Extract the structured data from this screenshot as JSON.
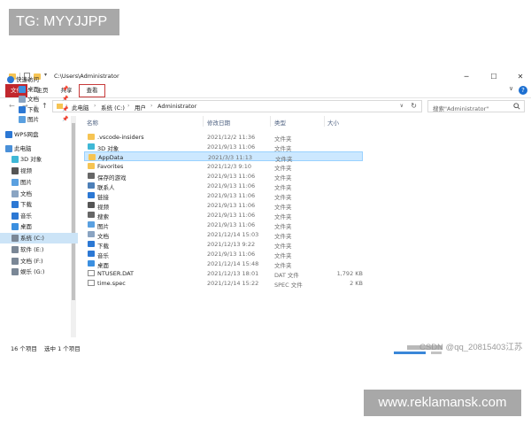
{
  "tags": {
    "top": "TG: MYYJJPP",
    "bottom": "www.reklamansk.com"
  },
  "window": {
    "path": "C:\\Users\\Administrator",
    "controls": {
      "minimize": "─",
      "maximize": "☐",
      "close": "✕"
    }
  },
  "ribbon": {
    "tabs": [
      "文件",
      "主页",
      "共享",
      "查看"
    ],
    "collapse": "∨",
    "help": "?"
  },
  "address": {
    "breadcrumb": [
      "此电脑",
      "系统 (C:)",
      "用户",
      "Administrator"
    ],
    "separator": "›",
    "search_placeholder": "搜索\"Administrator\""
  },
  "sidebar": {
    "items": [
      {
        "label": "快速访问",
        "icon": "star-icon",
        "pinned": false
      },
      {
        "label": "桌面",
        "icon": "desktop-icon",
        "pinned": true
      },
      {
        "label": "文档",
        "icon": "document-icon",
        "pinned": true
      },
      {
        "label": "下载",
        "icon": "download-icon",
        "pinned": true
      },
      {
        "label": "图片",
        "icon": "picture-icon",
        "pinned": true
      },
      {
        "label": "WPS网盘",
        "icon": "cloud-icon",
        "pinned": false
      },
      {
        "label": "此电脑",
        "icon": "computer-icon",
        "pinned": false
      },
      {
        "label": "3D 对象",
        "icon": "cube-icon",
        "pinned": false
      },
      {
        "label": "视频",
        "icon": "video-icon",
        "pinned": false
      },
      {
        "label": "图片",
        "icon": "picture-icon",
        "pinned": false
      },
      {
        "label": "文档",
        "icon": "document-icon",
        "pinned": false
      },
      {
        "label": "下载",
        "icon": "download-icon",
        "pinned": false
      },
      {
        "label": "音乐",
        "icon": "music-icon",
        "pinned": false
      },
      {
        "label": "桌面",
        "icon": "desktop-icon",
        "pinned": false
      },
      {
        "label": "系统 (C:)",
        "icon": "drive-icon",
        "pinned": false
      },
      {
        "label": "软件 (E:)",
        "icon": "drive-icon",
        "pinned": false
      },
      {
        "label": "文档 (F:)",
        "icon": "drive-icon",
        "pinned": false
      },
      {
        "label": "娱乐 (G:)",
        "icon": "drive-icon",
        "pinned": false
      }
    ],
    "pin_glyph": "📌",
    "active_item": "系统 (C:)"
  },
  "columns": {
    "name": "名称",
    "date": "修改日期",
    "type": "类型",
    "size": "大小"
  },
  "files": [
    {
      "name": ".vscode-insiders",
      "date": "2021/12/2 11:36",
      "type": "文件夹",
      "size": "",
      "icon": "folder-icon"
    },
    {
      "name": "3D 对象",
      "date": "2021/9/13 11:06",
      "type": "文件夹",
      "size": "",
      "icon": "cube-icon"
    },
    {
      "name": "AppData",
      "date": "2021/3/3 11:13",
      "type": "文件夹",
      "size": "",
      "icon": "folder-icon",
      "selected": true
    },
    {
      "name": "Favorites",
      "date": "2021/12/3 9:10",
      "type": "文件夹",
      "size": "",
      "icon": "folder-icon"
    },
    {
      "name": "保存的游戏",
      "date": "2021/9/13 11:06",
      "type": "文件夹",
      "size": "",
      "icon": "game-icon"
    },
    {
      "name": "联系人",
      "date": "2021/9/13 11:06",
      "type": "文件夹",
      "size": "",
      "icon": "contacts-icon"
    },
    {
      "name": "链接",
      "date": "2021/9/13 11:06",
      "type": "文件夹",
      "size": "",
      "icon": "link-icon"
    },
    {
      "name": "视频",
      "date": "2021/9/13 11:06",
      "type": "文件夹",
      "size": "",
      "icon": "video-icon"
    },
    {
      "name": "搜索",
      "date": "2021/9/13 11:06",
      "type": "文件夹",
      "size": "",
      "icon": "search-folder-icon"
    },
    {
      "name": "图片",
      "date": "2021/9/13 11:06",
      "type": "文件夹",
      "size": "",
      "icon": "picture-icon"
    },
    {
      "name": "文档",
      "date": "2021/12/14 15:03",
      "type": "文件夹",
      "size": "",
      "icon": "document-icon"
    },
    {
      "name": "下载",
      "date": "2021/12/13 9:22",
      "type": "文件夹",
      "size": "",
      "icon": "download-icon"
    },
    {
      "name": "音乐",
      "date": "2021/9/13 11:06",
      "type": "文件夹",
      "size": "",
      "icon": "music-icon"
    },
    {
      "name": "桌面",
      "date": "2021/12/14 15:48",
      "type": "文件夹",
      "size": "",
      "icon": "desktop-icon"
    },
    {
      "name": "NTUSER.DAT",
      "date": "2021/12/13 18:01",
      "type": "DAT 文件",
      "size": "1,792 KB",
      "icon": "file-icon"
    },
    {
      "name": "time.spec",
      "date": "2021/12/14 15:22",
      "type": "SPEC 文件",
      "size": "2 KB",
      "icon": "file-icon"
    }
  ],
  "status": {
    "count": "16 个项目",
    "selected": "选中 1 个项目"
  },
  "watermark": "CSDN @qq_20815403江苏",
  "colors": {
    "accent": "#1c6fd1",
    "file_tab": "#c1272d",
    "selection": "#cce8ff",
    "folder": "#f6c453"
  }
}
